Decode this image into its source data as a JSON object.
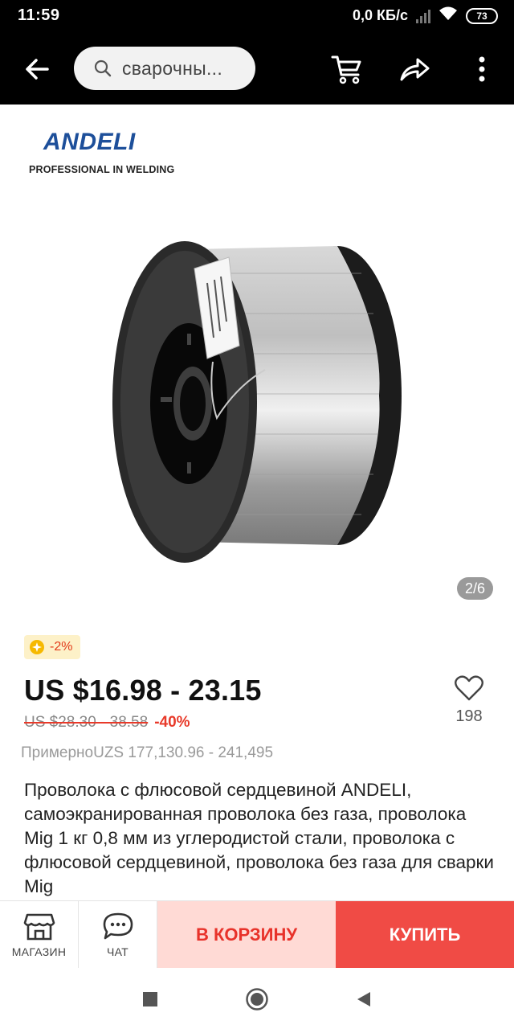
{
  "status_bar": {
    "time": "11:59",
    "network_speed": "0,0 КБ/с",
    "battery": "73"
  },
  "toolbar": {
    "search_text": "сварочны...",
    "icons": [
      "back-arrow-icon",
      "search-icon",
      "cart-icon",
      "share-icon",
      "more-vert-icon"
    ]
  },
  "gallery": {
    "brand_name": "ANDELI",
    "brand_tagline": "PROFESSIONAL IN WELDING",
    "counter": "2/6"
  },
  "product": {
    "coin_discount": "-2%",
    "price": "US $16.98 - 23.15",
    "old_price": "US $28.30 - 38.58",
    "discount": "-40%",
    "approx_price": "ПримерноUZS 177,130.96 - 241,495",
    "wishlist_count": "198",
    "title": "Проволока с флюсовой сердцевиной ANDELI, самоэкранированная проволока без газа, проволока Mig 1 кг 0,8 мм из углеродистой стали, проволока с флюсовой сердцевиной, проволока без газа для сварки Mig"
  },
  "action_bar": {
    "store_label": "МАГАЗИН",
    "chat_label": "ЧАТ",
    "add_to_cart": "В КОРЗИНУ",
    "buy_now": "КУПИТЬ"
  },
  "colors": {
    "accent_red": "#f04b45",
    "cart_bg": "#ffdad5",
    "brand_blue": "#1d4f9a",
    "coin_bg": "#fdf1c8"
  }
}
